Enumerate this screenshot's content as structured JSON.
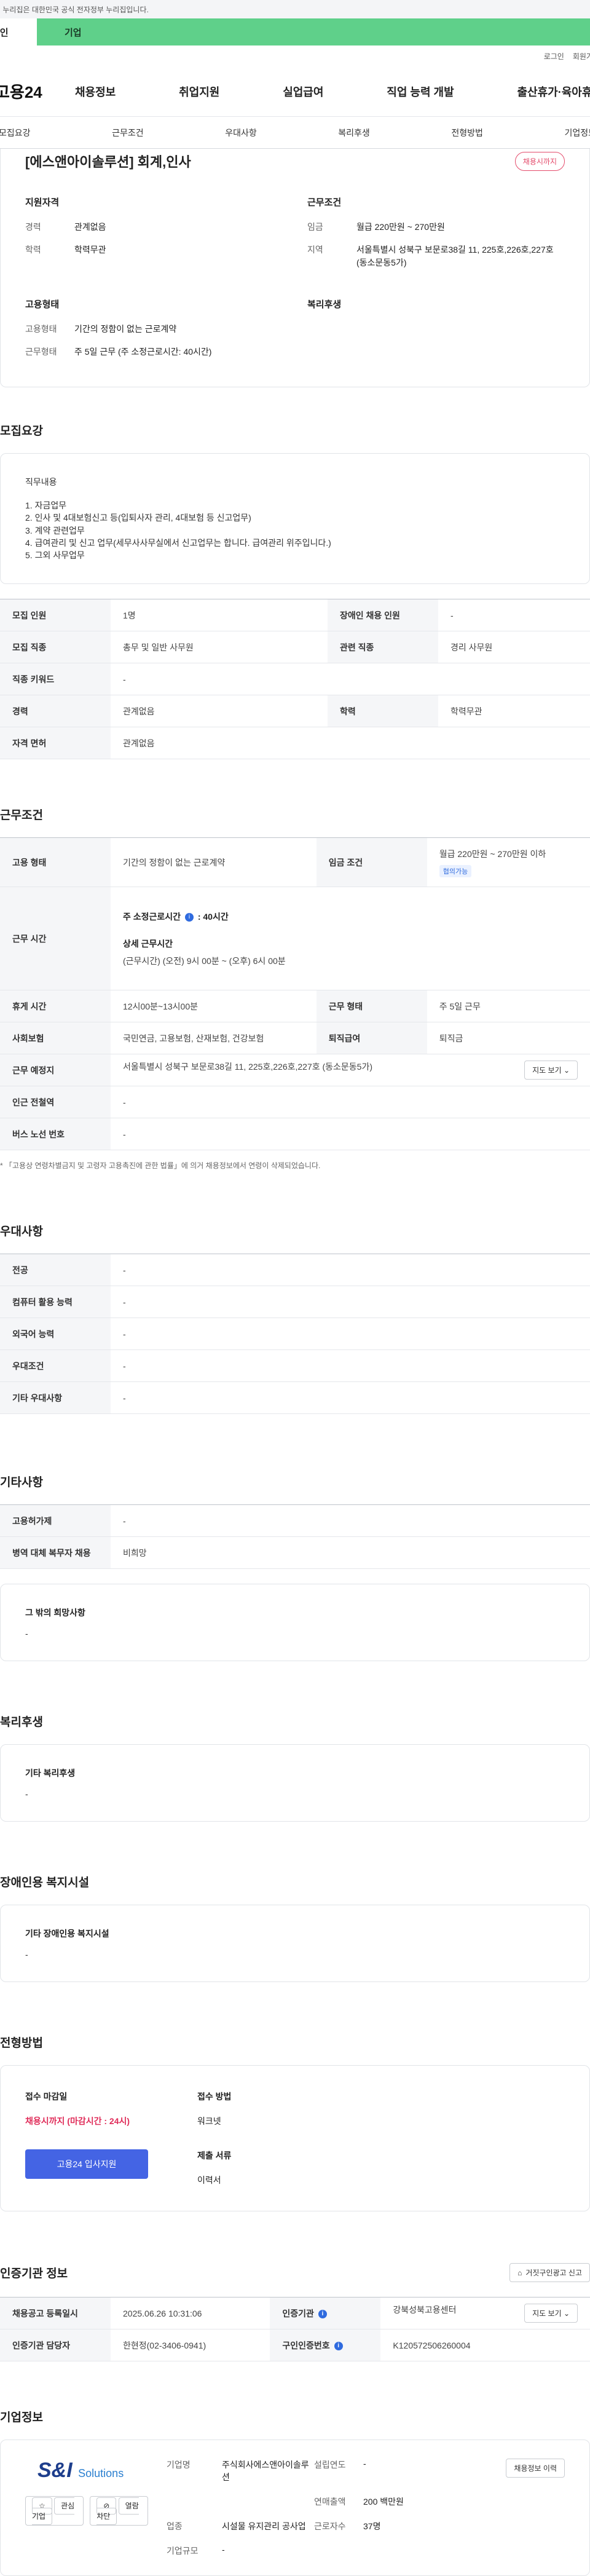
{
  "notice": "이 누리집은 대한민국 공식 전자정부 누리집입니다.",
  "env": {
    "left": "개인",
    "right": "기업"
  },
  "util": {
    "login": "로그인",
    "join": "회원가입"
  },
  "logo": "고용24",
  "gnb": [
    "채용정보",
    "취업지원",
    "실업급여",
    "직업 능력 개발",
    "출산휴가·육아휴직"
  ],
  "tabs": [
    "모집요강",
    "근무조건",
    "우대사항",
    "복리후생",
    "전형방법",
    "기업정보"
  ],
  "summary": {
    "title": "[에스앤아이솔루션] 회계,인사",
    "status": "채용시까지",
    "qual_heading": "지원자격",
    "career_k": "경력",
    "career_v": "관계없음",
    "edu_k": "학력",
    "edu_v": "학력무관",
    "cond_heading": "근무조건",
    "wage_k": "임금",
    "wage_v": "월급 220만원 ~ 270만원",
    "area_k": "지역",
    "area_v": "서울특별시 성북구 보문로38길 11, 225호,226호,227호 (동소문동5가)",
    "emp_heading": "고용형태",
    "type_k": "고용형태",
    "type_v": "기간의 정함이 없는 근로계약",
    "form_k": "근무형태",
    "form_v": "주 5일 근무 (주 소정근로시간: 40시간)",
    "welfare_heading": "복리후생"
  },
  "recruit": {
    "title": "모집요강",
    "duty_heading": "직무내용",
    "duties": [
      "1. 자금업무",
      "2. 인사 및 4대보험신고 등(입퇴사자 관리, 4대보험 등 신고업무)",
      "3. 계약 관련업무",
      "4. 급여관리 및 신고 업무(세무사사무실에서 신고업무는 합니다. 급여관리 위주입니다.)",
      "5. 그외 사무업무"
    ],
    "headcount_k": "모집 인원",
    "headcount_v": "1명",
    "disabled_k": "장애인 채용 인원",
    "disabled_v": "-",
    "job_k": "모집 직종",
    "job_v": "총무 및 일반 사무원",
    "related_k": "관련 직종",
    "related_v": "경리 사무원",
    "keyword_k": "직종 키워드",
    "keyword_v": "-",
    "career_k": "경력",
    "career_v": "관계없음",
    "edu_k": "학력",
    "edu_v": "학력무관",
    "license_k": "자격 면허",
    "license_v": "관계없음"
  },
  "work": {
    "title": "근무조건",
    "type_k": "고용 형태",
    "type_v": "기간의 정함이 없는 근로계약",
    "wage_k": "임금 조건",
    "wage_v": "월급 220만원 ~ 270만원 이하",
    "wage_tag": "협의가능",
    "hours_k": "근무 시간",
    "hours_label": "주 소정근로시간",
    "hours_value": ": 40시간",
    "hours_detail_label": "상세 근무시간",
    "hours_detail": "(근무시간) (오전) 9시 00분 ~ (오후) 6시 00분",
    "break_k": "휴게 시간",
    "break_v": "12시00분~13시00분",
    "shape_k": "근무 형태",
    "shape_v": "주 5일 근무",
    "insurance_k": "사회보험",
    "insurance_v": "국민연금, 고용보험, 산재보험, 건강보험",
    "retire_k": "퇴직급여",
    "retire_v": "퇴직금",
    "place_k": "근무 예정지",
    "place_v": "서울특별시 성북구 보문로38길 11, 225호,226호,227호 (동소문동5가)",
    "map_btn": "지도 보기",
    "subway_k": "인근 전철역",
    "subway_v": "-",
    "bus_k": "버스 노선 번호",
    "bus_v": "-",
    "note": "* 「고용상 연령차별금지 및 고령자 고용촉진에 관한 법률」에 의거 채용정보에서 연령이 삭제되었습니다."
  },
  "pref": {
    "title": "우대사항",
    "rows": [
      {
        "k": "전공",
        "v": "-"
      },
      {
        "k": "컴퓨터 활용 능력",
        "v": "-"
      },
      {
        "k": "외국어 능력",
        "v": "-"
      },
      {
        "k": "우대조건",
        "v": "-"
      },
      {
        "k": "기타 우대사항",
        "v": "-"
      }
    ]
  },
  "etc": {
    "title": "기타사항",
    "emp_k": "고용허가제",
    "emp_v": "-",
    "mil_k": "병역 대체 복무자 채용",
    "mil_v": "비희망",
    "other_title": "그 밖의 희망사항",
    "other_v": "-"
  },
  "welfare": {
    "title": "복리후생",
    "box_title": "기타 복리후생",
    "box_v": "-"
  },
  "disab": {
    "title": "장애인용 복지시설",
    "box_title": "기타 장애인용 복지시설",
    "box_v": "-"
  },
  "apply": {
    "title": "전형방법",
    "deadline_k": "접수 마감일",
    "deadline_v": "채용시까지 (마감시간 : 24시)",
    "btn": "고용24 입사지원",
    "method_k": "접수 방법",
    "method_v": "워크넷",
    "docs_k": "제출 서류",
    "docs_v": "이력서"
  },
  "auth": {
    "title": "인증기관 정보",
    "report_btn": "거짓구인광고 신고",
    "reg_k": "채용공고 등록일시",
    "reg_v": "2025.06.26 10:31:06",
    "org_k": "인증기관",
    "org_v": "강북성북고용센터",
    "map_btn": "지도 보기",
    "manager_k": "인증기관 담당자",
    "manager_v": "한현정(02-3406-0941)",
    "num_k": "구인인증번호",
    "num_v": "K120572506260004"
  },
  "company": {
    "title": "기업정보",
    "logo_text": "S&I",
    "logo_sub": "Solutions",
    "btn_interest": "관심기업",
    "btn_block": "열람차단",
    "btn_history": "채용정보 이력",
    "name_k": "기업명",
    "name_v": "주식회사에스앤아이솔루션",
    "year_k": "설립연도",
    "year_v": "-",
    "sales_k": "연매출액",
    "sales_v": "200 백만원",
    "ind_k": "업종",
    "ind_v": "시설물 유지관리 공사업",
    "emp_k": "근로자수",
    "emp_v": "37명",
    "size_k": "기업규모",
    "size_v": "-"
  }
}
